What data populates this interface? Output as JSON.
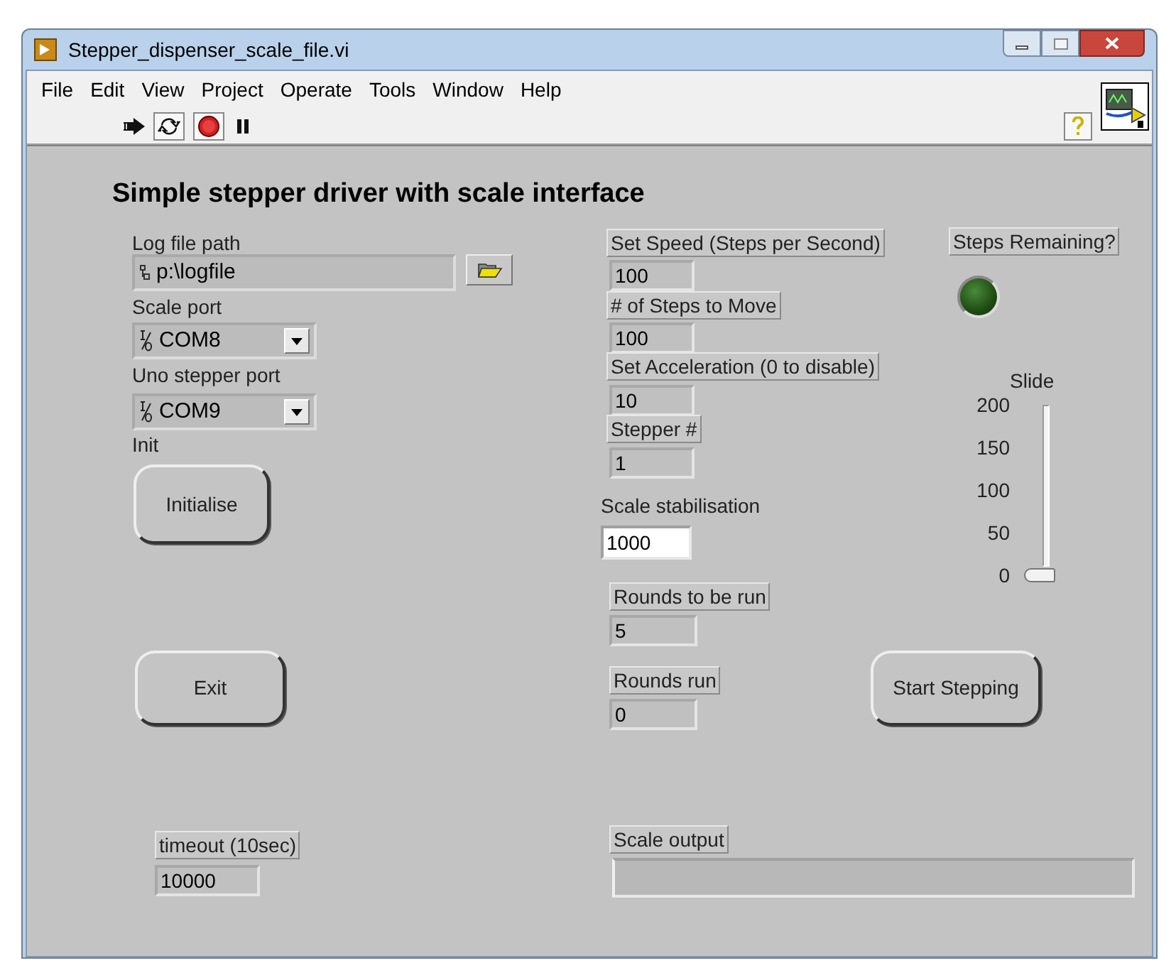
{
  "window": {
    "title": "Stepper_dispenser_scale_file.vi"
  },
  "menu": [
    "File",
    "Edit",
    "View",
    "Project",
    "Operate",
    "Tools",
    "Window",
    "Help"
  ],
  "panel_title": "Simple stepper driver with scale interface",
  "controls": [
    {
      "kind": "path",
      "label": "Log file path",
      "value": "p:\\logfile"
    },
    {
      "kind": "ring",
      "label": "Scale port",
      "value": "COM8"
    },
    {
      "kind": "ring",
      "label": "Uno stepper port",
      "value": "COM9"
    },
    {
      "kind": "button",
      "label": "Init",
      "text": "Initialise"
    },
    {
      "kind": "numeric_indicator",
      "label": "Set Speed (Steps per Second)",
      "value": "100"
    },
    {
      "kind": "numeric_indicator",
      "label": "# of Steps to Move",
      "value": "100"
    },
    {
      "kind": "numeric_indicator",
      "label": "Set Acceleration (0 to disable)",
      "value": "10"
    },
    {
      "kind": "numeric_indicator",
      "label": "Stepper #",
      "value": "1"
    },
    {
      "kind": "numeric_control",
      "label": "Scale stabilisation",
      "value": "1000"
    },
    {
      "kind": "numeric_indicator",
      "label": "Rounds to be run",
      "value": "5"
    },
    {
      "kind": "numeric_indicator",
      "label": "Rounds run",
      "value": "0"
    },
    {
      "kind": "numeric_indicator",
      "label": "timeout (10sec)",
      "value": "10000"
    },
    {
      "kind": "button",
      "text": "Exit"
    },
    {
      "kind": "button",
      "text": "Start Stepping"
    },
    {
      "kind": "led",
      "label": "Steps Remaining?",
      "on": false
    },
    {
      "kind": "slide",
      "label": "Slide",
      "ticks": [
        "200",
        "150",
        "100",
        "50",
        "0"
      ],
      "level": 0
    },
    {
      "kind": "string_indicator",
      "label": "Scale output"
    }
  ]
}
